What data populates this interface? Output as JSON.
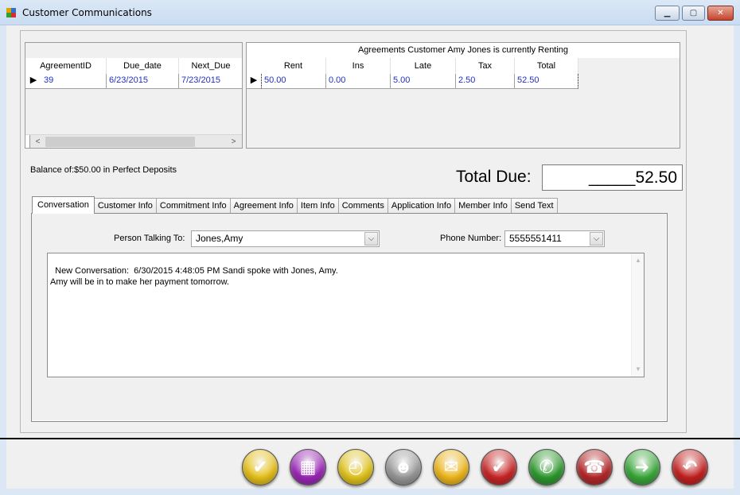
{
  "window": {
    "title": "Customer Communications",
    "minimize": "▁",
    "maximize": "▢",
    "close": "✕"
  },
  "grid_left": {
    "columns": [
      "AgreementID",
      "Due_date",
      "Next_Due"
    ],
    "row": [
      "39",
      "6/23/2015",
      "7/23/2015"
    ],
    "selector": "▶",
    "scroll_left": "<",
    "scroll_right": ">"
  },
  "grid_right": {
    "caption": "Agreements Customer Amy  Jones is currently Renting",
    "columns": [
      "Rent",
      "Ins",
      "Late",
      "Tax",
      "Total"
    ],
    "row": [
      "50.00",
      "0.00",
      "5.00",
      "2.50",
      "52.50"
    ],
    "selector": "▶"
  },
  "balance_text": "Balance of:$50.00 in Perfect Deposits",
  "total_due": {
    "label": "Total Due:",
    "value": "_____52.50"
  },
  "tabs": [
    "Conversation",
    "Customer Info",
    "Commitment Info",
    "Agreement Info",
    "Item Info",
    "Comments",
    "Application Info",
    "Member Info",
    "Send Text"
  ],
  "conversation": {
    "person_label": "Person Talking To:",
    "person_value": "Jones,Amy",
    "phone_label": "Phone Number:",
    "phone_value": "5555551411",
    "dropdown_glyph": "⌵",
    "text": "New Conversation:  6/30/2015 4:48:05 PM Sandi spoke with Jones, Amy.\nAmy will be in to make her payment tomorrow."
  },
  "toolbar": [
    {
      "icon": "check-icon",
      "glyph": "✔",
      "color": "#e8c21a"
    },
    {
      "icon": "calculator-icon",
      "glyph": "▦",
      "color": "#9b27b7"
    },
    {
      "icon": "stopwatch-icon",
      "glyph": "◴",
      "color": "#e3c51d"
    },
    {
      "icon": "customer-icon",
      "glyph": "☻",
      "color": "#9a9a9a"
    },
    {
      "icon": "envelope-icon",
      "glyph": "✉",
      "color": "#f0b81c"
    },
    {
      "icon": "check-comment-icon",
      "glyph": "✔",
      "color": "#c82626"
    },
    {
      "icon": "chat-phone-icon",
      "glyph": "✆",
      "color": "#2e9a2e"
    },
    {
      "icon": "phone-search-icon",
      "glyph": "☎",
      "color": "#b5282a"
    },
    {
      "icon": "arrow-right-icon",
      "glyph": "➜",
      "color": "#3aa83a"
    },
    {
      "icon": "undo-icon",
      "glyph": "↶",
      "color": "#c42121"
    }
  ]
}
